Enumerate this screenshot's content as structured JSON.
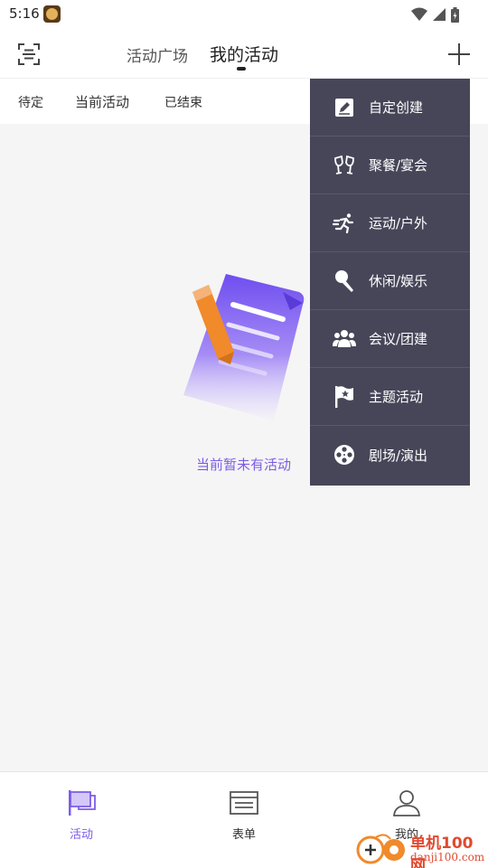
{
  "status_bar": {
    "time": "5:16"
  },
  "header": {
    "tabs": [
      {
        "label": "活动广场",
        "active": false
      },
      {
        "label": "我的活动",
        "active": true
      }
    ],
    "left_icon": "scan-icon",
    "right_icon": "plus-icon"
  },
  "filters": [
    {
      "label": "待定"
    },
    {
      "label": "当前活动"
    },
    {
      "label": "已结束"
    }
  ],
  "empty_state": {
    "message": "当前暂未有活动"
  },
  "dropdown": {
    "items": [
      {
        "label": "自定创建",
        "icon": "edit-icon"
      },
      {
        "label": "聚餐/宴会",
        "icon": "wine-glasses-icon"
      },
      {
        "label": "运动/户外",
        "icon": "running-icon"
      },
      {
        "label": "休闲/娱乐",
        "icon": "microphone-icon"
      },
      {
        "label": "会议/团建",
        "icon": "group-icon"
      },
      {
        "label": "主题活动",
        "icon": "star-flag-icon"
      },
      {
        "label": "剧场/演出",
        "icon": "film-reel-icon"
      }
    ]
  },
  "bottom_nav": {
    "items": [
      {
        "label": "活动",
        "icon": "flag-icon",
        "active": true
      },
      {
        "label": "表单",
        "icon": "form-icon",
        "active": false
      },
      {
        "label": "我的",
        "icon": "user-icon",
        "active": false
      }
    ]
  },
  "watermark": {
    "title": "单机100网",
    "url": "danji100.com"
  },
  "colors": {
    "accent": "#7c5ce8",
    "dropdown_bg": "#474659",
    "watermark": "#e0492f"
  }
}
